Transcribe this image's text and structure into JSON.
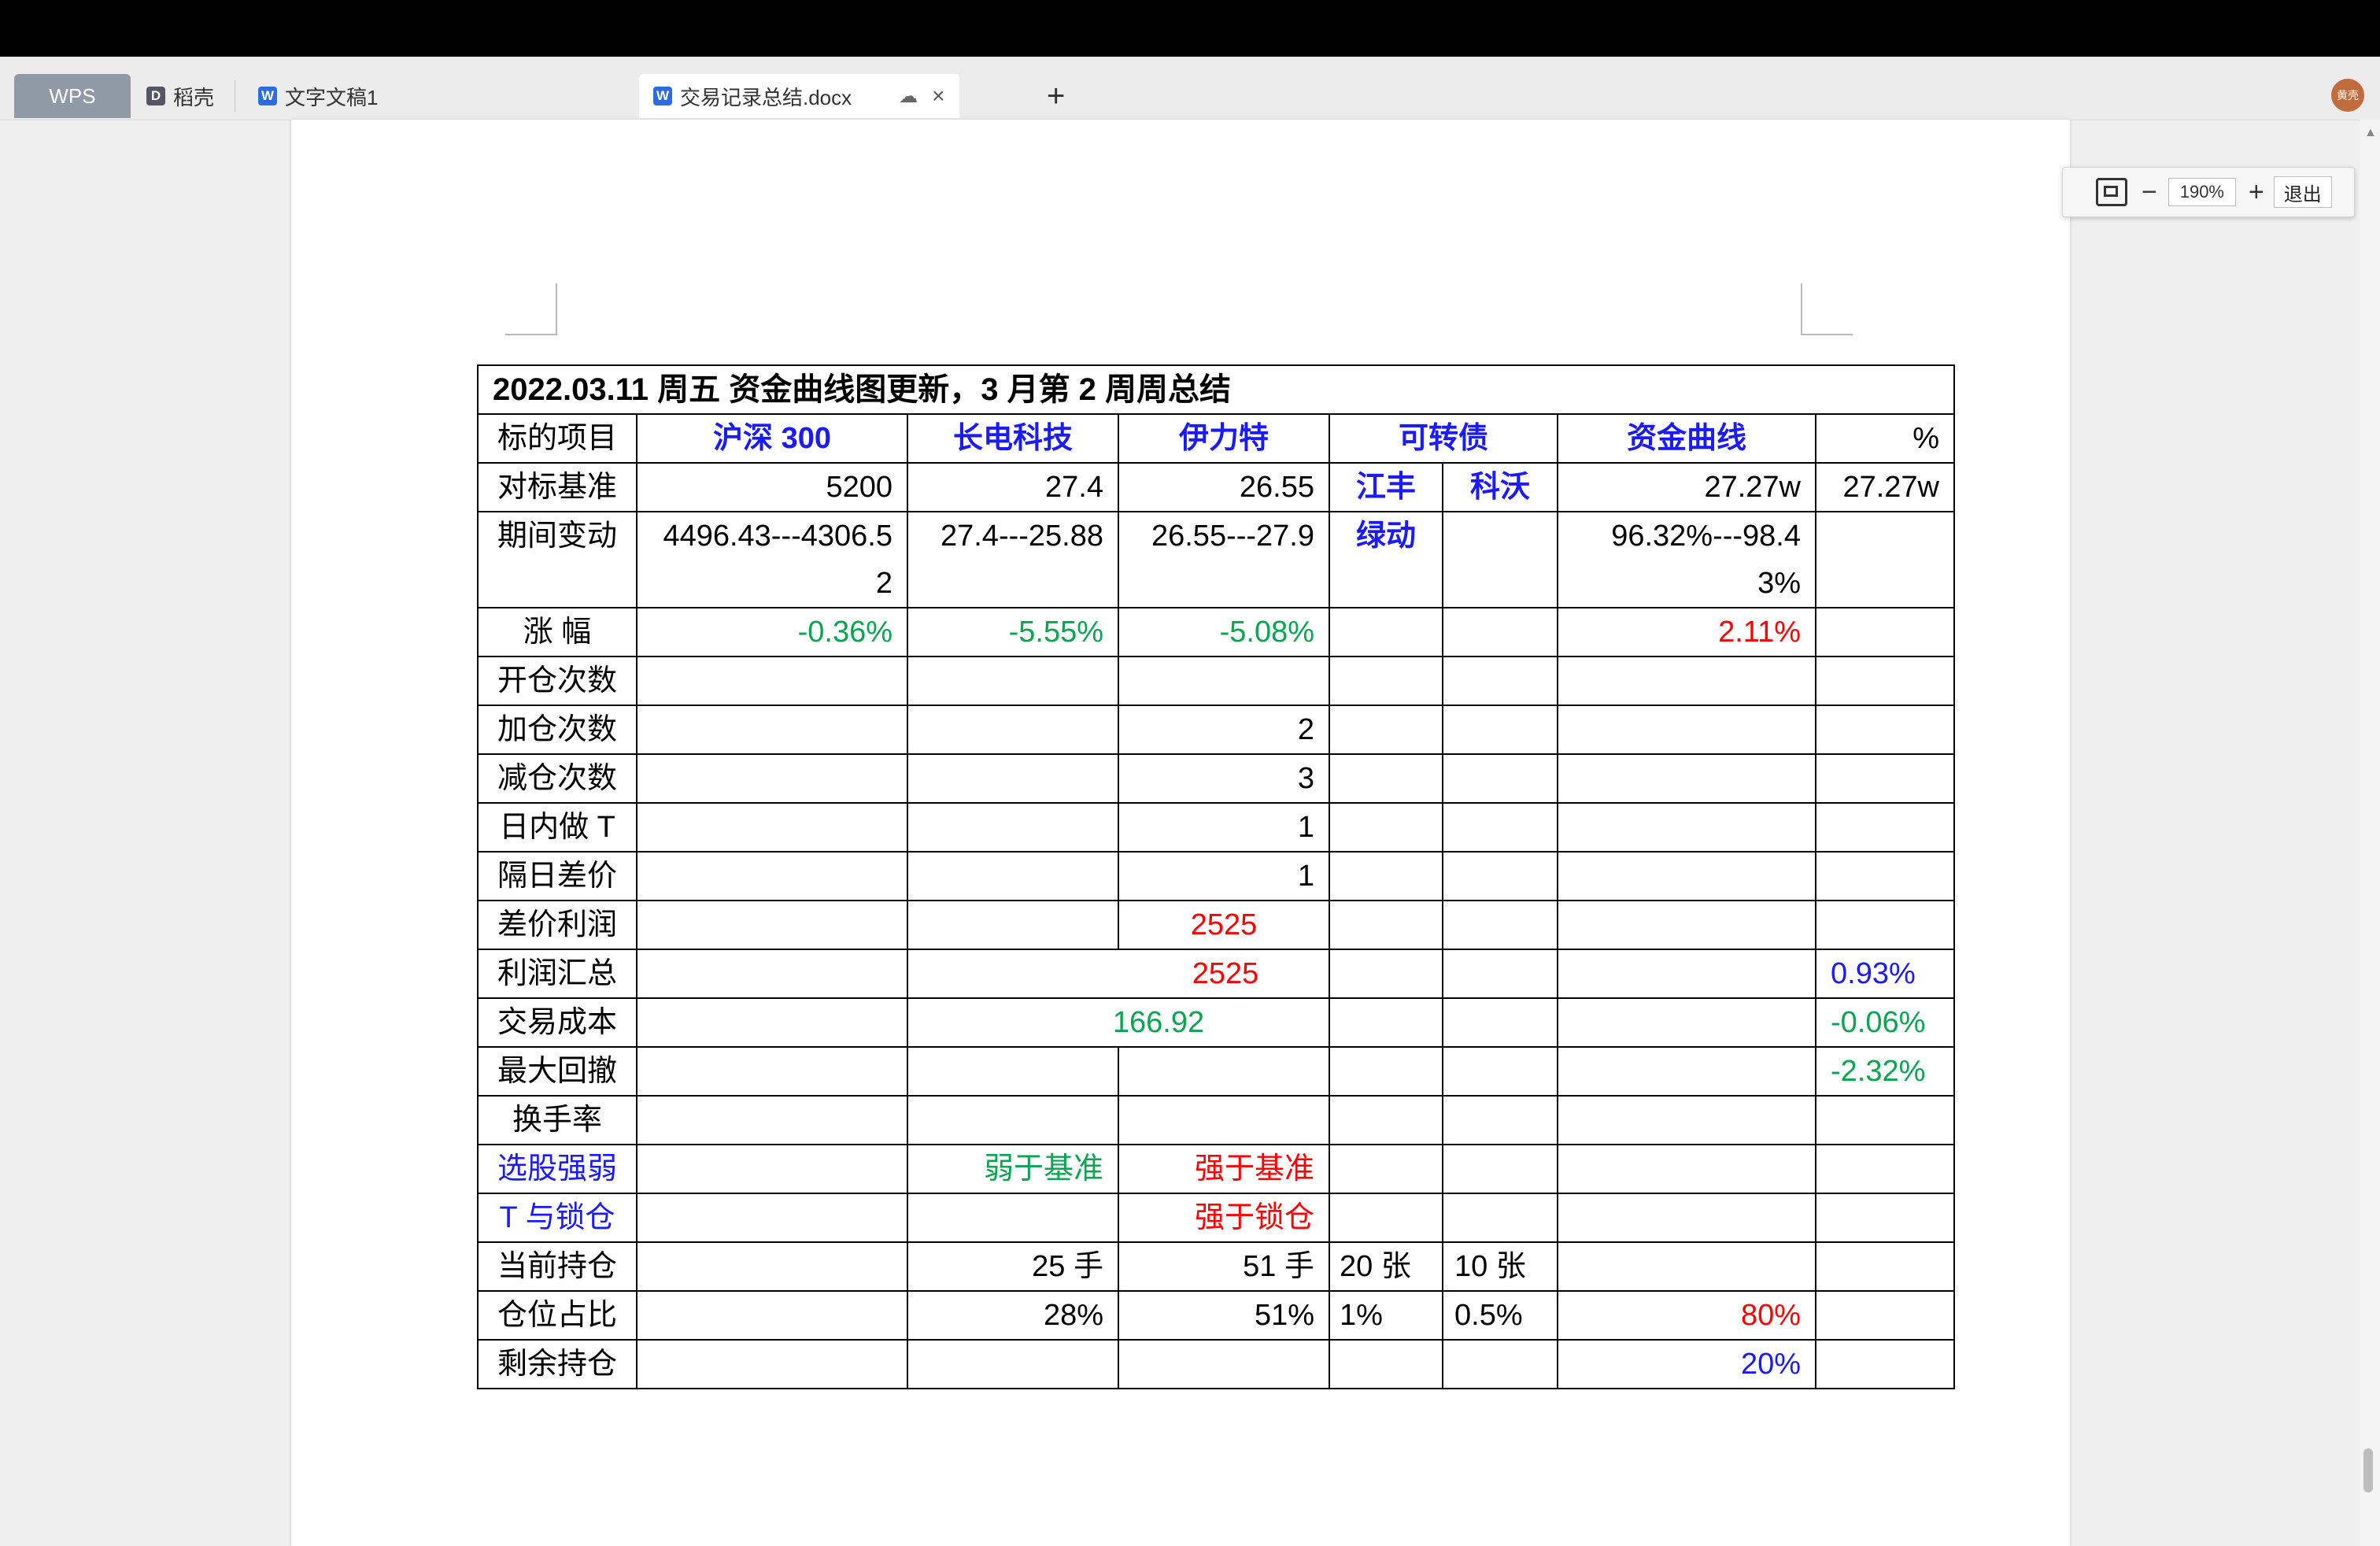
{
  "tabs": {
    "wps": "WPS",
    "daoke": "稻壳",
    "doc1": "文字文稿1",
    "active": "交易记录总结.docx",
    "new_tab": "+",
    "avatar": "黄壳"
  },
  "zoom": {
    "level": "190%",
    "minus": "−",
    "plus": "+",
    "exit": "退出"
  },
  "colors": {
    "blue": "#1a1aff",
    "green": "#0aa550",
    "red": "#ff0000",
    "wps_tab": "#8f9aa6"
  },
  "table": {
    "title": "2022.03.11 周五 资金曲线图更新，3 月第 2 周周总结",
    "header": {
      "label": "标的项目",
      "hs300": "沪深 300",
      "changdian": "长电科技",
      "yilite": "伊力特",
      "kezhuanzhai": "可转债",
      "zijinquxian": "资金曲线",
      "pct": "%"
    },
    "benchmark": {
      "label": "对标基准",
      "hs300": "5200",
      "changdian": "27.4",
      "yilite": "26.55",
      "jiangfeng": "江丰",
      "kewo": "科沃",
      "zijin": "27.27w",
      "pct": "27.27w"
    },
    "change": {
      "label": "期间变动",
      "hs300": "4496.43---4306.52",
      "changdian": "27.4---25.88",
      "yilite": "26.55---27.9",
      "lvdong": "绿动",
      "zijin": "96.32%---98.43%"
    },
    "rise": {
      "label": "涨 幅",
      "hs300": "-0.36%",
      "changdian": "-5.55%",
      "yilite": "-5.08%",
      "zijin": "2.11%"
    },
    "open_count": {
      "label": "开仓次数"
    },
    "add_count": {
      "label": "加仓次数",
      "yilite": "2"
    },
    "reduce_count": {
      "label": "减仓次数",
      "yilite": "3"
    },
    "intraday_t": {
      "label": "日内做 T",
      "yilite": "1"
    },
    "overnight_diff": {
      "label": "隔日差价",
      "yilite": "1"
    },
    "diff_profit": {
      "label": "差价利润",
      "yilite": "2525"
    },
    "profit_total": {
      "label": "利润汇总",
      "value": "2525",
      "pct": "0.93%"
    },
    "trade_cost": {
      "label": "交易成本",
      "value": "166.92",
      "pct": "-0.06%"
    },
    "max_drawdown": {
      "label": "最大回撤",
      "pct": "-2.32%"
    },
    "turnover": {
      "label": "换手率"
    },
    "stock_strength": {
      "label": "选股强弱",
      "changdian": "弱于基准",
      "yilite": "强于基准"
    },
    "t_vs_lock": {
      "label": "T 与锁仓",
      "yilite": "强于锁仓"
    },
    "current_pos": {
      "label": "当前持仓",
      "changdian": "25 手",
      "yilite": "51 手",
      "jiangfeng": "20 张",
      "kewo": "10 张"
    },
    "pos_ratio": {
      "label": "仓位占比",
      "changdian": "28%",
      "yilite": "51%",
      "jiangfeng": "1%",
      "kewo": "0.5%",
      "zijin": "80%"
    },
    "remaining": {
      "label": "剩余持仓",
      "zijin": "20%"
    }
  }
}
